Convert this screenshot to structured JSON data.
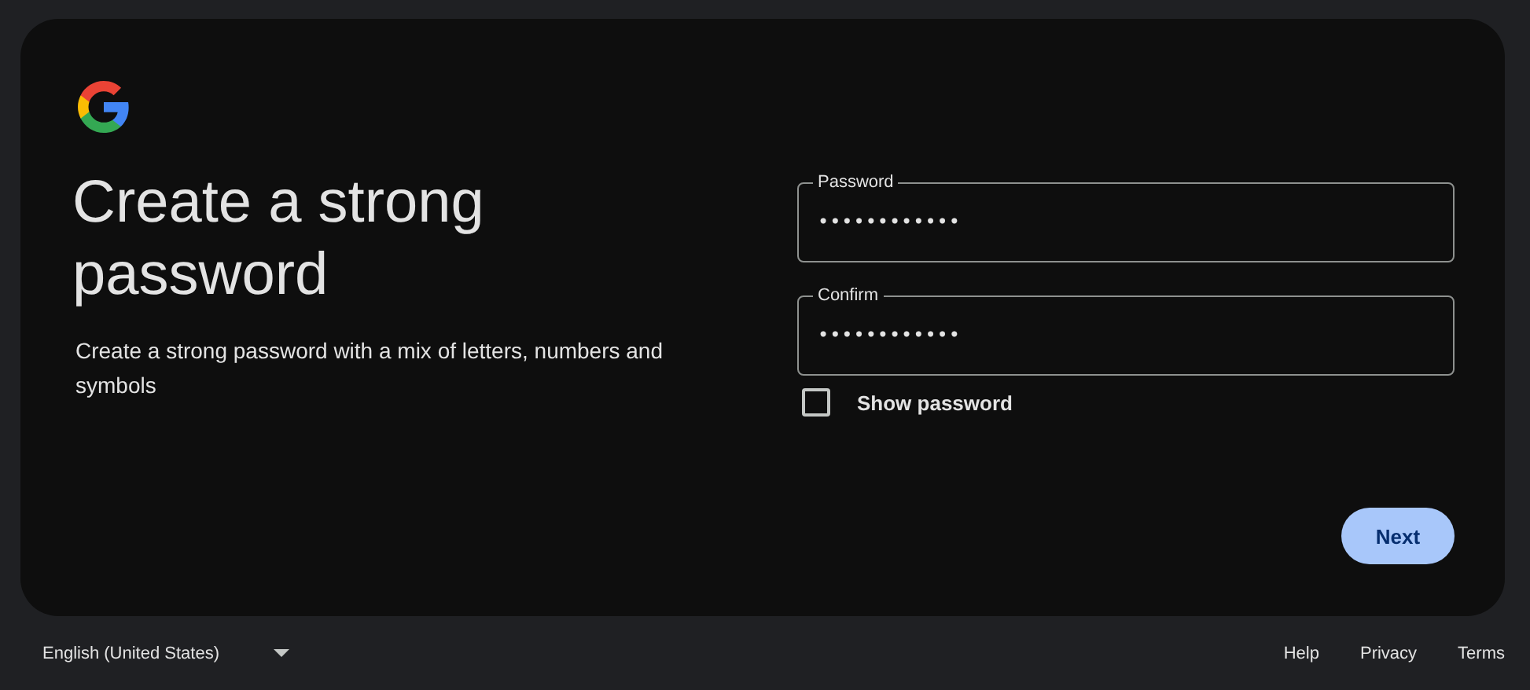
{
  "heading": "Create a strong password",
  "description": "Create a strong password with a mix of letters, numbers and symbols",
  "fields": [
    {
      "label": "Password",
      "value": "••••••••••••"
    },
    {
      "label": "Confirm",
      "value": "••••••••••••"
    }
  ],
  "show_password": {
    "label": "Show password",
    "checked": false
  },
  "next_button": "Next",
  "footer": {
    "language": "English (United States)",
    "links": [
      "Help",
      "Privacy",
      "Terms"
    ]
  }
}
